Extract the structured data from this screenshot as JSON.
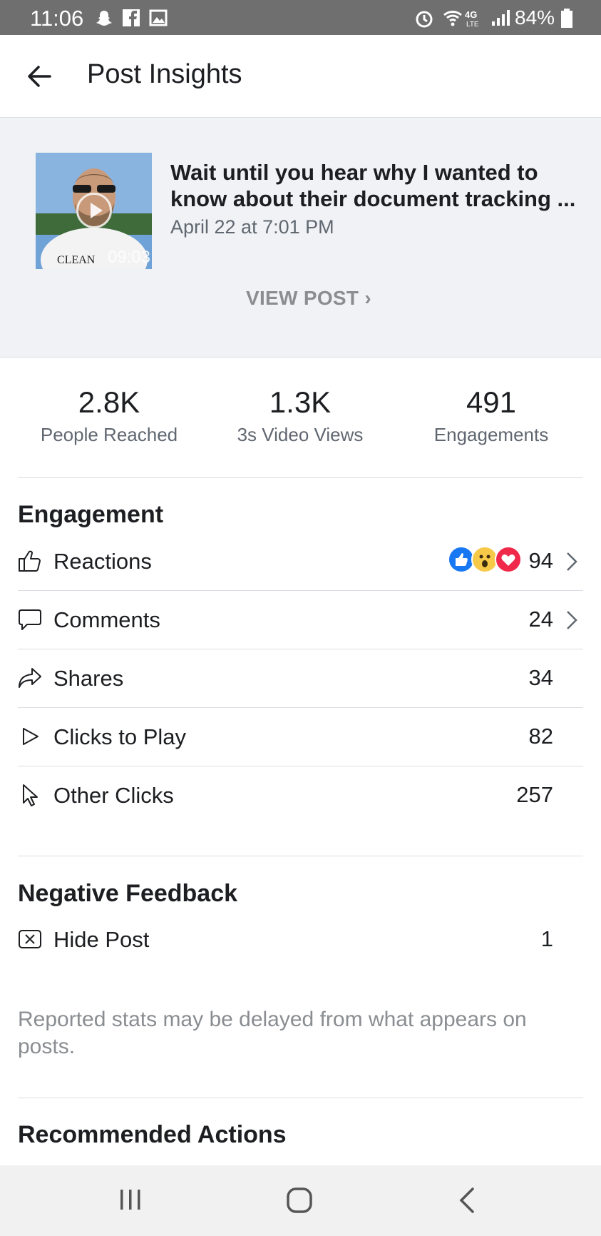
{
  "status_bar": {
    "time": "11:06",
    "battery": "84%",
    "icons": [
      "snapchat-icon",
      "facebook-icon",
      "image-icon",
      "alarm-icon",
      "wifi-icon",
      "4g-lte-icon",
      "signal-icon",
      "battery-icon"
    ]
  },
  "header": {
    "title": "Post Insights",
    "back_icon": "arrow-left-icon"
  },
  "post": {
    "text": "Wait until you hear why I wanted to know about their document tracking ...",
    "date": "April 22 at 7:01 PM",
    "video_duration": "09:03",
    "view_post_label": "VIEW POST ›"
  },
  "summary": [
    {
      "value": "2.8K",
      "label": "People Reached"
    },
    {
      "value": "1.3K",
      "label": "3s Video Views"
    },
    {
      "value": "491",
      "label": "Engagements"
    }
  ],
  "engagement": {
    "title": "Engagement",
    "rows": [
      {
        "label": "Reactions",
        "count": "94",
        "icon": "thumbs-up-icon",
        "has_chevron": true,
        "reaction_icons": [
          "like",
          "wow",
          "love"
        ]
      },
      {
        "label": "Comments",
        "count": "24",
        "icon": "comment-icon",
        "has_chevron": true
      },
      {
        "label": "Shares",
        "count": "34",
        "icon": "share-icon",
        "has_chevron": false
      },
      {
        "label": "Clicks to Play",
        "count": "82",
        "icon": "play-icon",
        "has_chevron": false
      },
      {
        "label": "Other Clicks",
        "count": "257",
        "icon": "cursor-icon",
        "has_chevron": false
      }
    ]
  },
  "negative_feedback": {
    "title": "Negative Feedback",
    "rows": [
      {
        "label": "Hide Post",
        "count": "1",
        "icon": "hide-post-icon"
      }
    ]
  },
  "note": "Reported stats may be delayed from what appears on posts.",
  "recommended": {
    "title": "Recommended Actions"
  },
  "colors": {
    "like_blue": "#1877f2",
    "wow_yellow": "#f7c948",
    "love_red": "#f02849",
    "muted_text": "#606770",
    "card_bg": "#f0f2f5"
  }
}
